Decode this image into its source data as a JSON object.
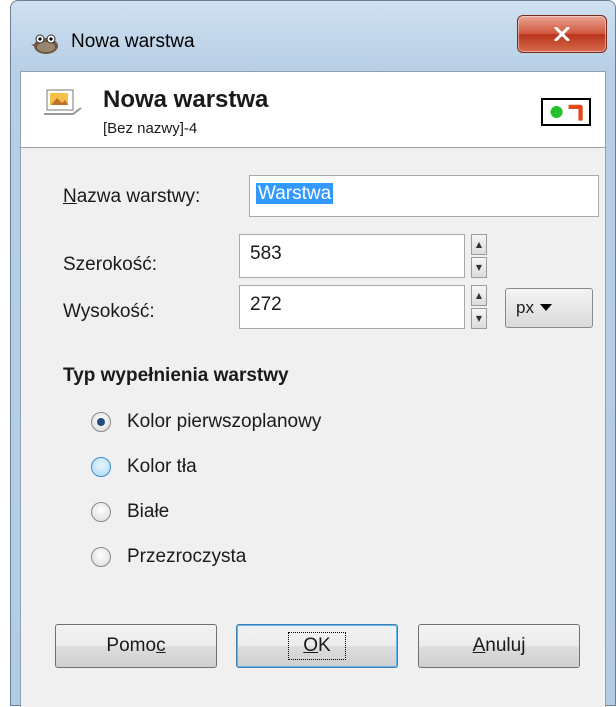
{
  "window": {
    "title": "Nowa warstwa",
    "close_label": "X"
  },
  "header": {
    "title": "Nowa warstwa",
    "subtitle": "[Bez nazwy]-4"
  },
  "form": {
    "name_label": "Nazwa warstwy:",
    "name_value": "Warstwa",
    "width_label": "Szerokość:",
    "width_value": "583",
    "height_label": "Wysokość:",
    "height_value": "272",
    "unit": "px"
  },
  "fill": {
    "title": "Typ wypełnienia warstwy",
    "options": [
      {
        "label": "Kolor pierwszoplanowy",
        "checked": true
      },
      {
        "label": "Kolor tła",
        "checked": false
      },
      {
        "label": "Białe",
        "checked": false
      },
      {
        "label": "Przezroczysta",
        "checked": false
      }
    ]
  },
  "buttons": {
    "help": "Pomoc",
    "ok": "OK",
    "cancel": "Anuluj"
  },
  "colors": {
    "titlebar": "#b8cfe6",
    "selection": "#3399ff",
    "close": "#c8442a"
  },
  "icons": {
    "app": "gimp-wilber-icon",
    "layer": "new-layer-icon",
    "preview": "layer-preview-icon"
  }
}
